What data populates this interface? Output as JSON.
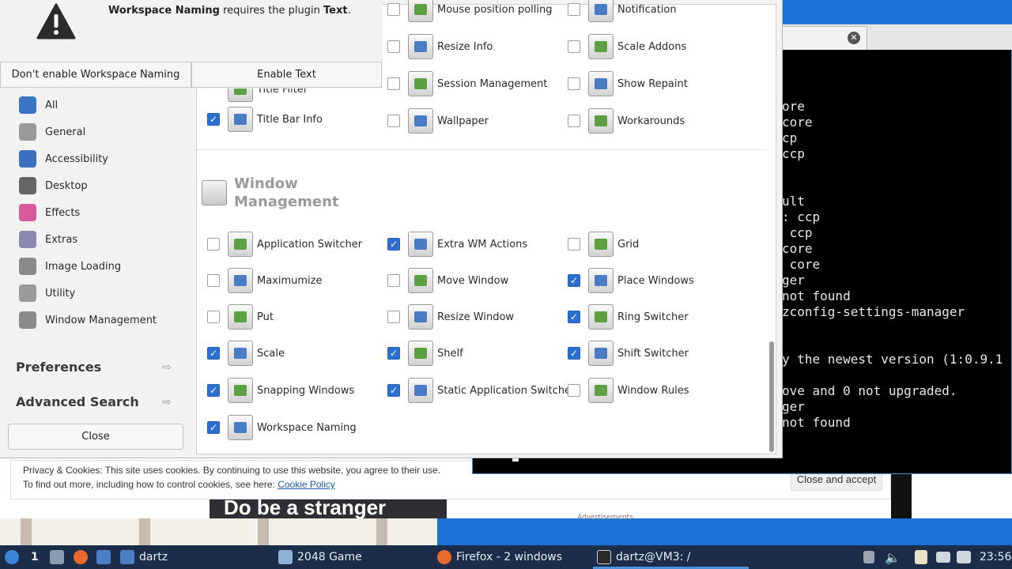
{
  "dialog": {
    "message_parts": [
      "Workspace Naming",
      " requires the plugin ",
      "Text",
      "."
    ],
    "buttons": {
      "dont_enable": "Don't enable Workspace Naming",
      "enable": "Enable Text"
    }
  },
  "sidebar": {
    "categories": [
      {
        "label": "All",
        "icon": "globe-icon",
        "color": "#3a74c4"
      },
      {
        "label": "General",
        "icon": "gears-icon",
        "color": "#9a9a9a"
      },
      {
        "label": "Accessibility",
        "icon": "accessibility-icon",
        "color": "#3b6fc0"
      },
      {
        "label": "Desktop",
        "icon": "desktop-icon",
        "color": "#666666"
      },
      {
        "label": "Effects",
        "icon": "effects-icon",
        "color": "#d95a9a"
      },
      {
        "label": "Extras",
        "icon": "extras-icon",
        "color": "#8a8ab0"
      },
      {
        "label": "Image Loading",
        "icon": "image-loading-icon",
        "color": "#8a8a8a"
      },
      {
        "label": "Utility",
        "icon": "utility-icon",
        "color": "#9a9a9a"
      },
      {
        "label": "Window Management",
        "icon": "window-management-icon",
        "color": "#8a8a8a"
      }
    ],
    "preferences": "Preferences",
    "advanced_search": "Advanced Search",
    "close": "Close"
  },
  "plugins_top": {
    "col1": [
      {
        "label": "Title Filter",
        "checked": null
      },
      {
        "label": "Title Bar Info",
        "checked": true
      }
    ],
    "col2": [
      {
        "label": "Mouse position polling",
        "checked": false
      },
      {
        "label": "Resize Info",
        "checked": false
      },
      {
        "label": "Session Management",
        "checked": false
      },
      {
        "label": "Wallpaper",
        "checked": false
      }
    ],
    "col3": [
      {
        "label": "Notification",
        "checked": false
      },
      {
        "label": "Scale Addons",
        "checked": false
      },
      {
        "label": "Show Repaint",
        "checked": false
      },
      {
        "label": "Workarounds",
        "checked": false
      }
    ]
  },
  "group_title": "Window Management",
  "plugins_wm": [
    [
      {
        "label": "Application Switcher",
        "checked": false
      },
      {
        "label": "Maximumize",
        "checked": false
      },
      {
        "label": "Put",
        "checked": false
      },
      {
        "label": "Scale",
        "checked": true
      },
      {
        "label": "Snapping Windows",
        "checked": true
      },
      {
        "label": "Workspace Naming",
        "checked": true
      }
    ],
    [
      {
        "label": "Extra WM Actions",
        "checked": true
      },
      {
        "label": "Move Window",
        "checked": false
      },
      {
        "label": "Resize Window",
        "checked": false
      },
      {
        "label": "Shelf",
        "checked": true
      },
      {
        "label": "Static Application Switcher",
        "checked": true
      }
    ],
    [
      {
        "label": "Grid",
        "checked": false
      },
      {
        "label": "Place Windows",
        "checked": true
      },
      {
        "label": "Ring Switcher",
        "checked": true
      },
      {
        "label": "Shift Switcher",
        "checked": true
      },
      {
        "label": "Window Rules",
        "checked": false
      }
    ]
  ],
  "terminal": {
    "lines": [
      "ore",
      "core",
      "cp",
      "ccp",
      "",
      "",
      "ult",
      ": ccp",
      " ccp",
      "core",
      " core",
      "ger",
      "not found",
      "zconfig-settings-manager",
      "",
      "",
      "y the newest version (1:0.9.1",
      "",
      "ove and 0 not upgraded.",
      "ger",
      "not found"
    ]
  },
  "browser": {
    "cookie_line1": "Privacy & Cookies: This site uses cookies. By continuing to use this website, you agree to their use.",
    "cookie_line2": "To find out more, including how to control cookies, see here: ",
    "cookie_link": "Cookie Policy",
    "cookie_button": "Close and accept",
    "ad_text": "Do be a\nstranger",
    "ad_label": "Advertisements"
  },
  "taskbar": {
    "workspace": "1",
    "tasks": [
      {
        "label": "dartz",
        "icon": "folder-icon"
      },
      {
        "label": "2048 Game",
        "icon": "window-icon"
      },
      {
        "label": "Firefox - 2 windows",
        "icon": "firefox-icon"
      },
      {
        "label": "dartz@VM3: /",
        "icon": "terminal-icon"
      }
    ],
    "clock": "23:56"
  }
}
